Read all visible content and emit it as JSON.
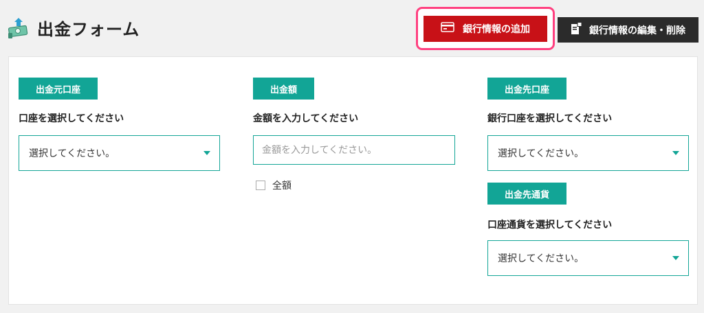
{
  "header": {
    "title": "出金フォーム",
    "icon": "money-transfer-icon"
  },
  "actions": {
    "add_bank_label": "銀行情報の追加",
    "edit_bank_label": "銀行情報の編集・削除"
  },
  "form": {
    "source_account": {
      "tag": "出金元口座",
      "label": "口座を選択してください",
      "selected": "選択してください。"
    },
    "amount": {
      "tag": "出金額",
      "label": "金額を入力してください",
      "placeholder": "金額を入力してください。",
      "full_amount_label": "全額"
    },
    "destination_account": {
      "tag": "出金先口座",
      "label": "銀行口座を選択してください",
      "selected": "選択してください。"
    },
    "destination_currency": {
      "tag": "出金先通貨",
      "label": "口座通貨を選択してください",
      "selected": "選択してください。"
    }
  },
  "colors": {
    "accent": "#12a596",
    "add_button": "#c81117",
    "highlight": "#ff3f7f",
    "edit_button": "#2b2b2b"
  }
}
